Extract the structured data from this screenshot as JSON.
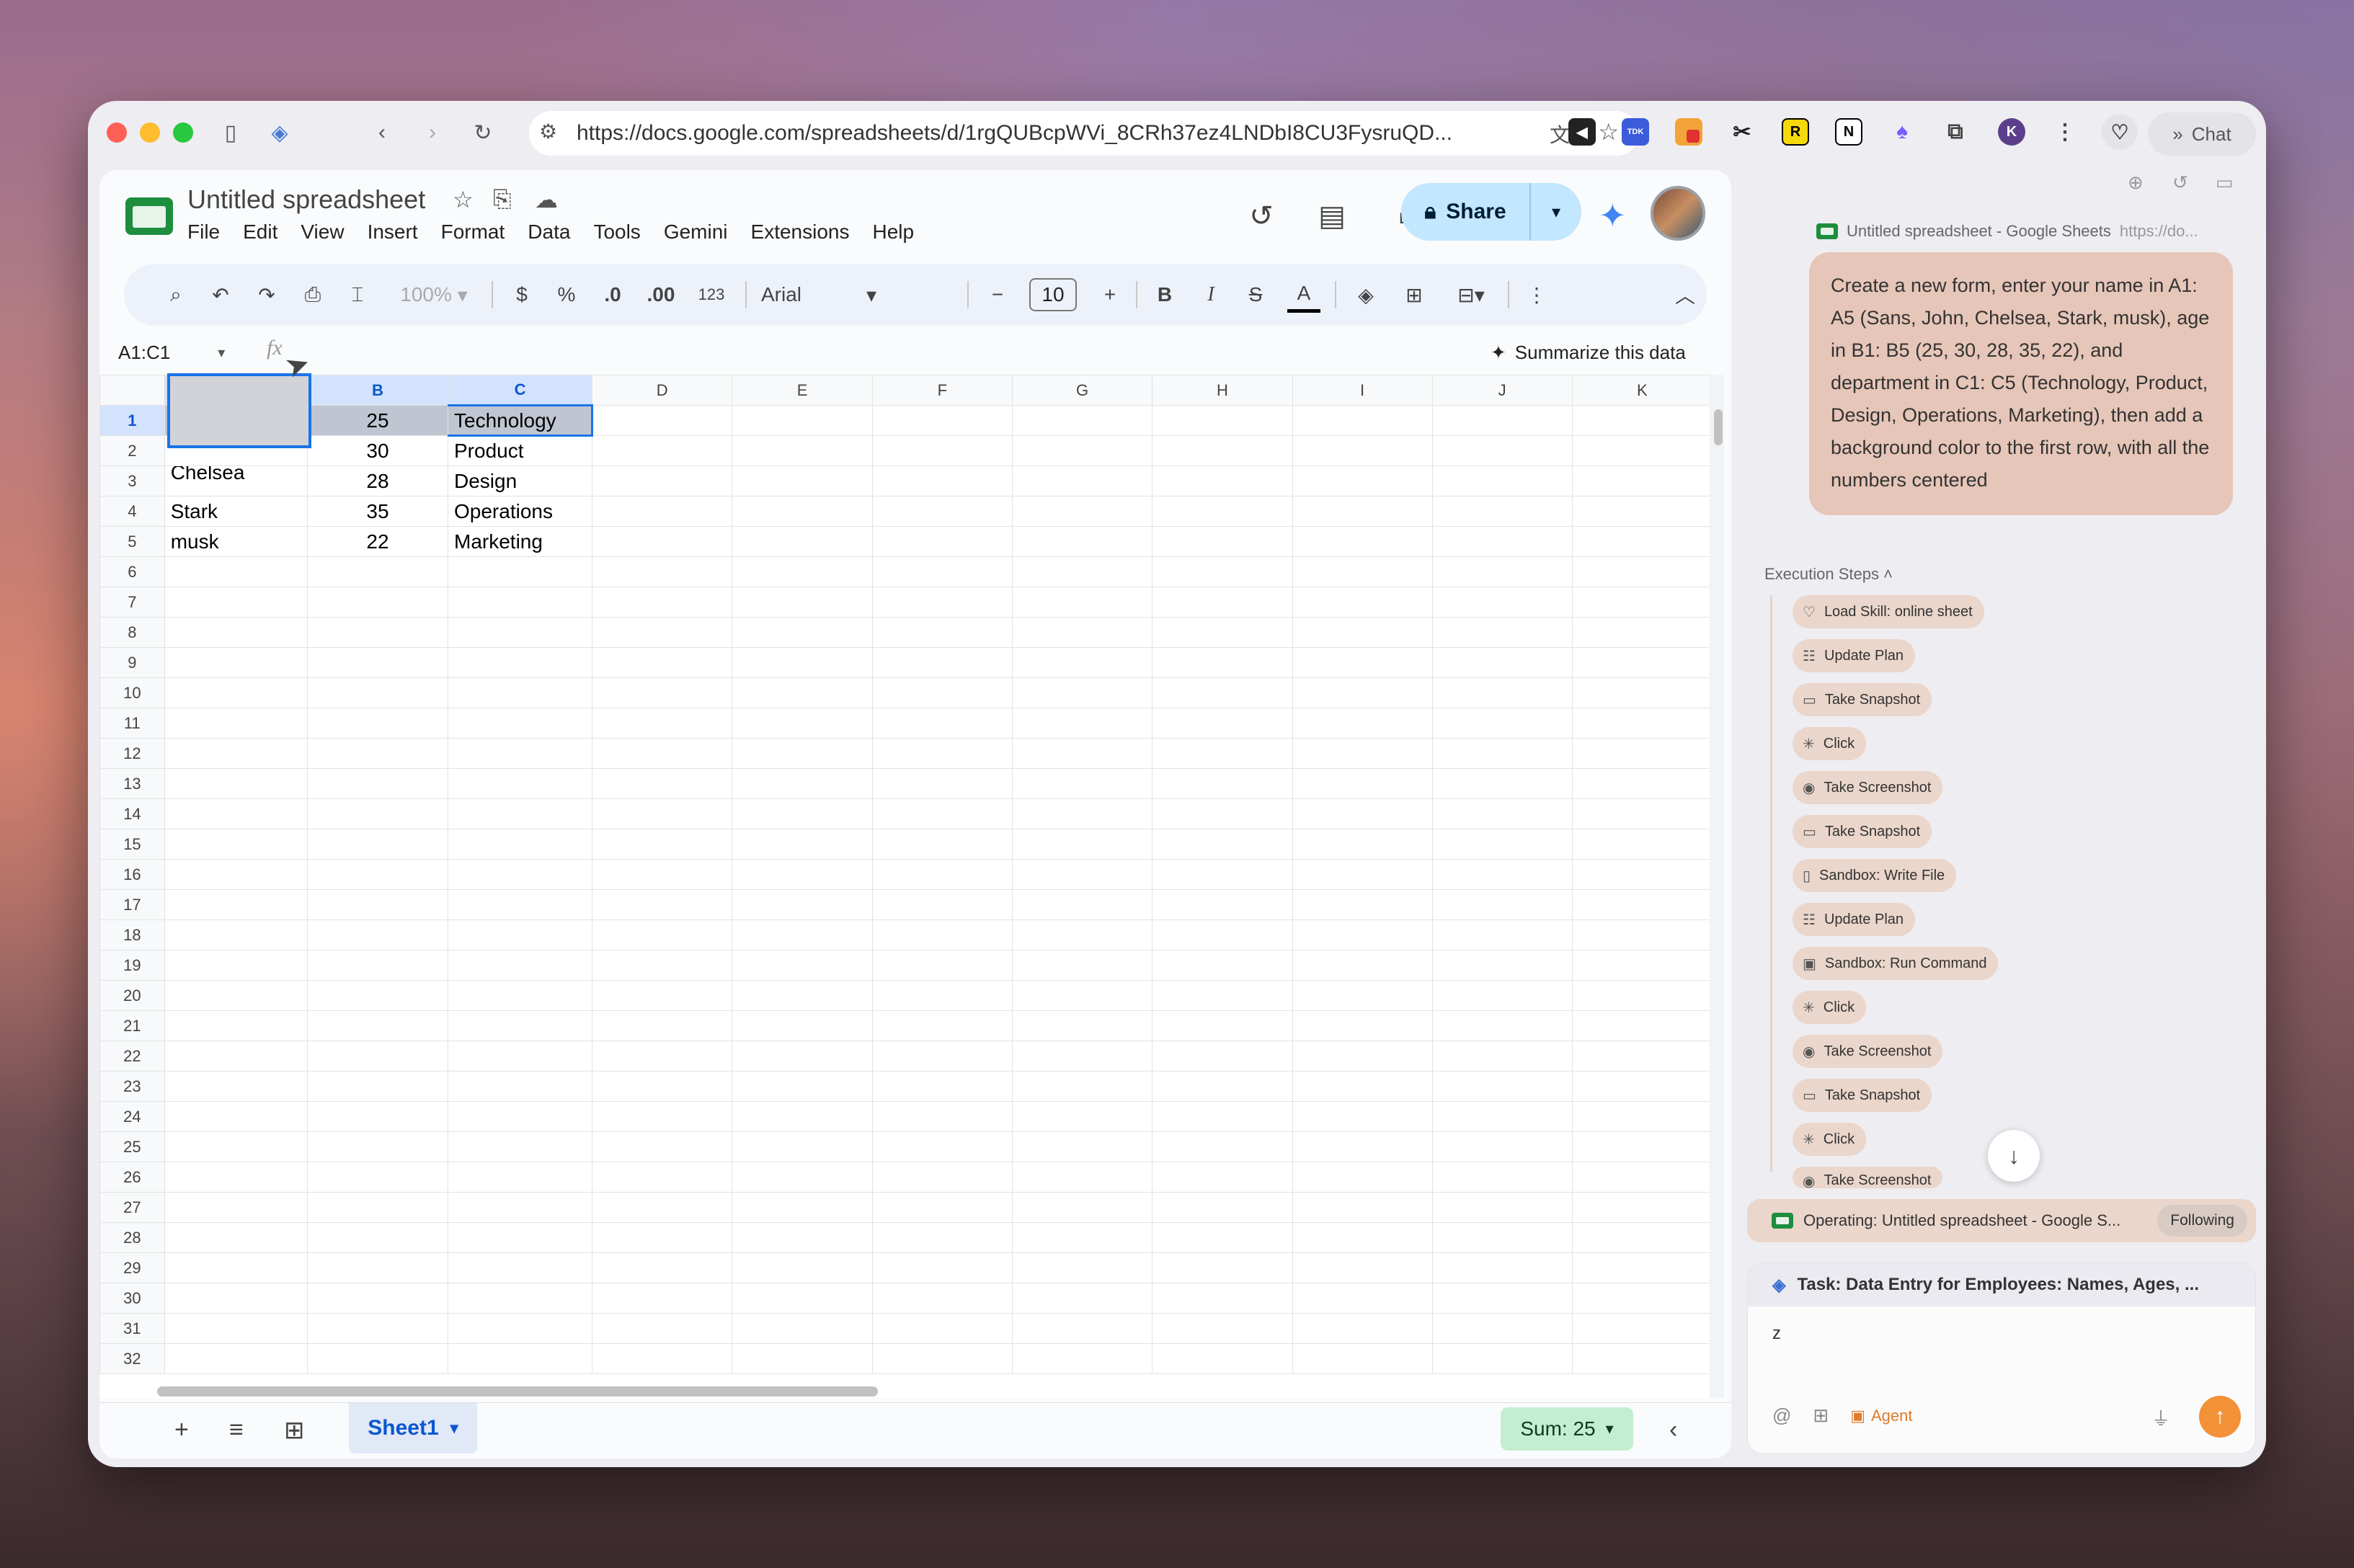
{
  "browser": {
    "url": "https://docs.google.com/spreadsheets/d/1rgQUBcpWVi_8CRh37ez4LNDbI8CU3FysruQD...",
    "chat_label": "Chat",
    "extension_tdk": "TDK",
    "extension_r": "R",
    "extension_n": "N"
  },
  "sheets": {
    "title": "Untitled spreadsheet",
    "menu": [
      "File",
      "Edit",
      "View",
      "Insert",
      "Format",
      "Data",
      "Tools",
      "Gemini",
      "Extensions",
      "Help"
    ],
    "share_label": "Share",
    "toolbar": {
      "zoom": "100%",
      "currency": "$",
      "percent": "%",
      "dec_decrease": ".0",
      "dec_increase": ".00",
      "number_format": "123",
      "font": "Arial",
      "font_size": "10"
    },
    "name_box": "A1:C1",
    "summarize_label": "Summarize this data",
    "columns": [
      "A",
      "B",
      "C",
      "D",
      "E",
      "F",
      "G",
      "H",
      "I",
      "J",
      "K"
    ],
    "rows": [
      {
        "n": "1",
        "a": "",
        "b": "25",
        "c": "Technology"
      },
      {
        "n": "2",
        "a": "",
        "b": "30",
        "c": "Product"
      },
      {
        "n": "3",
        "a": "Chelsea",
        "b": "28",
        "c": "Design"
      },
      {
        "n": "4",
        "a": "Stark",
        "b": "35",
        "c": "Operations"
      },
      {
        "n": "5",
        "a": "musk",
        "b": "22",
        "c": "Marketing"
      }
    ],
    "empty_rows": [
      "6",
      "7",
      "8",
      "9",
      "10",
      "11",
      "12",
      "13",
      "14",
      "15",
      "16",
      "17",
      "18",
      "19",
      "20",
      "21",
      "22",
      "23",
      "24",
      "25",
      "26",
      "27",
      "28",
      "29",
      "30",
      "31",
      "32"
    ],
    "sheet_tab": "Sheet1",
    "sum_label": "Sum: 25"
  },
  "panel": {
    "tab_ref_title": "Untitled spreadsheet - Google Sheets",
    "tab_ref_url": "https://do...",
    "message": "Create a new form, enter your name in A1: A5 (Sans, John, Chelsea, Stark, musk), age in B1: B5 (25, 30, 28, 35, 22), and department in C1: C5 (Technology, Product, Design, Operations, Marketing), then add a background color to the first row, with all the numbers centered",
    "execution_steps_label": "Execution Steps",
    "steps": [
      {
        "icon": "lightbulb-icon",
        "label": "Load Skill: online sheet"
      },
      {
        "icon": "checklist-icon",
        "label": "Update Plan"
      },
      {
        "icon": "window-icon",
        "label": "Take Snapshot"
      },
      {
        "icon": "click-icon",
        "label": "Click"
      },
      {
        "icon": "camera-icon",
        "label": "Take Screenshot"
      },
      {
        "icon": "window-icon",
        "label": "Take Snapshot"
      },
      {
        "icon": "file-icon",
        "label": "Sandbox: Write File"
      },
      {
        "icon": "checklist-icon",
        "label": "Update Plan"
      },
      {
        "icon": "terminal-icon",
        "label": "Sandbox: Run Command"
      },
      {
        "icon": "click-icon",
        "label": "Click"
      },
      {
        "icon": "camera-icon",
        "label": "Take Screenshot"
      },
      {
        "icon": "window-icon",
        "label": "Take Snapshot"
      },
      {
        "icon": "click-icon",
        "label": "Click"
      },
      {
        "icon": "camera-icon",
        "label": "Take Screenshot"
      }
    ],
    "operating_label": "Operating: Untitled spreadsheet - Google S...",
    "following_label": "Following",
    "task_label": "Task:  Data Entry for Employees: Names, Ages, ...",
    "input_value": "z",
    "agent_label": "Agent"
  },
  "colors": {
    "selection_blue": "#1a73e8",
    "share_bg": "#c2e7ff",
    "sum_bg": "#c4eed0",
    "bubble_bg": "#e6c6b8",
    "send_orange": "#f29138"
  }
}
